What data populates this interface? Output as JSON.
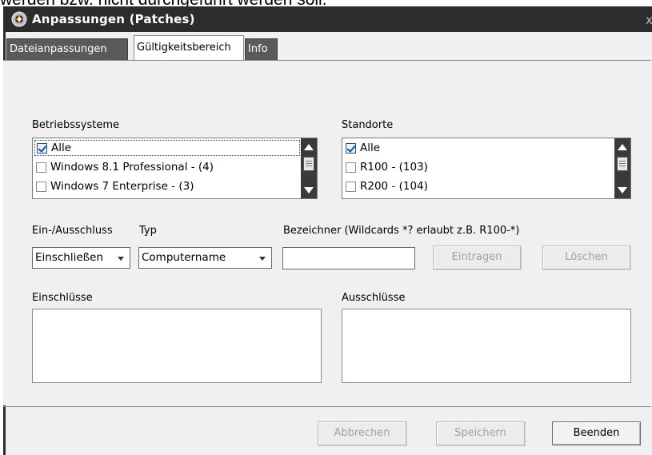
{
  "top_caption": "werden bzw. nicht durchgeführt werden soll.",
  "window": {
    "title": "Anpassungen (Patches)",
    "close_glyph": "x",
    "icon": "patches-app-icon"
  },
  "tabs": [
    {
      "label": "Dateianpassungen",
      "active": false
    },
    {
      "label": "Gültigkeitsbereich",
      "active": true
    },
    {
      "label": "Info",
      "active": false
    }
  ],
  "operating_systems": {
    "label": "Betriebssysteme",
    "items": [
      {
        "label": "Alle",
        "checked": true
      },
      {
        "label": "Windows 8.1 Professional - (4)",
        "checked": false
      },
      {
        "label": "Windows 7 Enterprise - (3)",
        "checked": false
      }
    ]
  },
  "locations": {
    "label": "Standorte",
    "items": [
      {
        "label": "Alle",
        "checked": true
      },
      {
        "label": "R100 - (103)",
        "checked": false
      },
      {
        "label": "R200 - (104)",
        "checked": false
      }
    ]
  },
  "filter": {
    "inclusion_label": "Ein-/Ausschluss",
    "inclusion_value": "Einschließen",
    "type_label": "Typ",
    "type_value": "Computername",
    "identifier_label": "Bezeichner (Wildcards *?  erlaubt z.B. R100-*)",
    "identifier_value": "",
    "add_button": "Eintragen",
    "delete_button": "Löschen"
  },
  "inclusions_label": "Einschlüsse",
  "exclusions_label": "Ausschlüsse",
  "footer": {
    "cancel": "Abbrechen",
    "save": "Speichern",
    "close": "Beenden"
  },
  "colors": {
    "titlebar": "#2c2c2c",
    "dialog_bg": "#f0f0f0",
    "checkbox_check": "#1b4f96"
  }
}
